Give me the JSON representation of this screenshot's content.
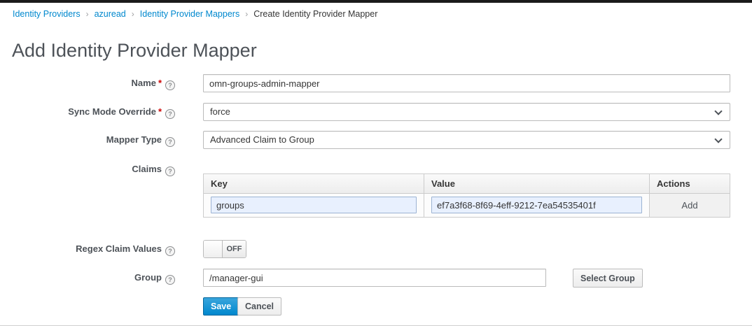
{
  "colors": {
    "accent_blue": "#0088ce",
    "required_red": "#cc0000",
    "save_button_blue": "#0088ce",
    "autofill_input_bg": "#e8f0fe"
  },
  "icons": {
    "help": "?",
    "breadcrumb_separator": "›"
  },
  "breadcrumb": {
    "items": [
      {
        "label": "Identity Providers"
      },
      {
        "label": "azuread"
      },
      {
        "label": "Identity Provider Mappers"
      },
      {
        "label": "Create Identity Provider Mapper"
      }
    ]
  },
  "page_title": "Add Identity Provider Mapper",
  "form": {
    "name": {
      "label": "Name",
      "required_marker": "*",
      "value": "omn-groups-admin-mapper"
    },
    "sync_mode_override": {
      "label": "Sync Mode Override",
      "required_marker": "*",
      "selected": "force"
    },
    "mapper_type": {
      "label": "Mapper Type",
      "selected": "Advanced Claim to Group"
    },
    "claims": {
      "label": "Claims",
      "headers": {
        "key": "Key",
        "value": "Value",
        "actions": "Actions"
      },
      "row": {
        "key": "groups",
        "value": "ef7a3f68-8f69-4eff-9212-7ea54535401f",
        "add_label": "Add"
      }
    },
    "regex_claim_values": {
      "label": "Regex Claim Values",
      "state": "OFF"
    },
    "group": {
      "label": "Group",
      "value": "/manager-gui",
      "select_button": "Select Group"
    },
    "buttons": {
      "save": "Save",
      "cancel": "Cancel"
    }
  }
}
